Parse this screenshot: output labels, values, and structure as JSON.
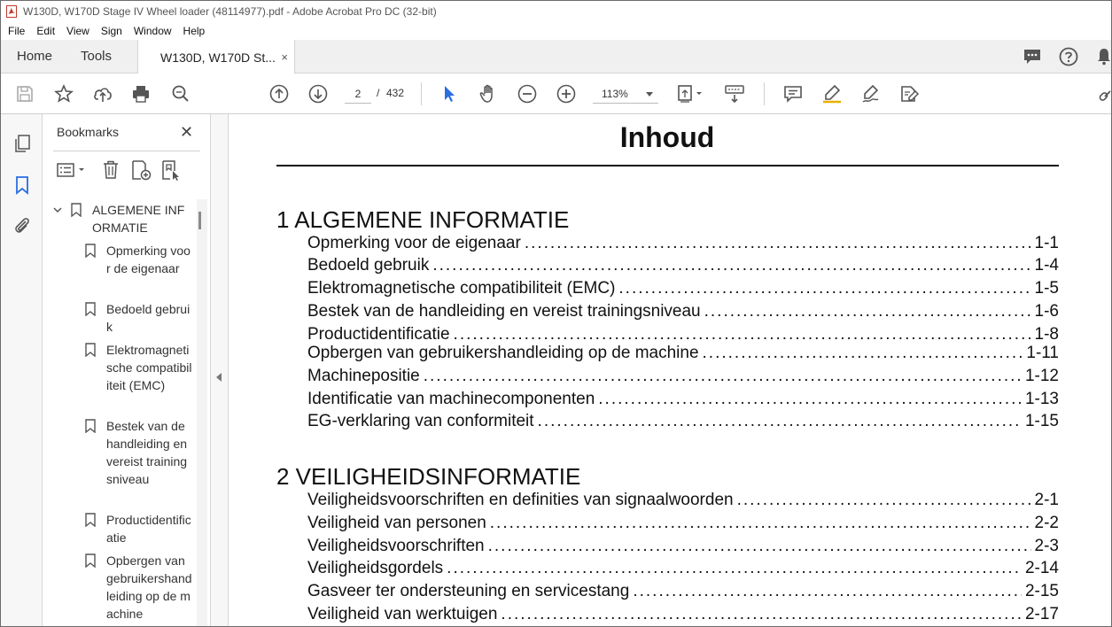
{
  "window": {
    "title": "W130D, W170D Stage IV Wheel loader (48114977).pdf - Adobe Acrobat Pro DC (32-bit)"
  },
  "menu": [
    "File",
    "Edit",
    "View",
    "Sign",
    "Window",
    "Help"
  ],
  "tabs": {
    "home": "Home",
    "tools": "Tools",
    "document": "W130D, W170D St...",
    "close": "×"
  },
  "toolbar": {
    "page_current": "2",
    "page_separator": "/",
    "page_total": "432",
    "zoom": "113%"
  },
  "bookmarks": {
    "header": "Bookmarks",
    "close": "✕",
    "items": [
      {
        "label": "ALGEMENE INFORMATIE",
        "level": 0
      },
      {
        "label": "Opmerking voor de eigenaar",
        "level": 1
      },
      {
        "label": "Bedoeld gebruik",
        "level": 1
      },
      {
        "label": "Elektromagnetische compatibiliteit (EMC)",
        "level": 1
      },
      {
        "label": "Bestek van de handleiding en vereist trainingsniveau",
        "level": 1
      },
      {
        "label": "Productidentificatie",
        "level": 1
      },
      {
        "label": "Opbergen van gebruikershandleiding op de machine",
        "level": 1
      }
    ]
  },
  "document": {
    "title": "Inhoud",
    "chapters": [
      {
        "heading": "1 ALGEMENE INFORMATIE",
        "entries": [
          {
            "text": "Opmerking voor de eigenaar",
            "page": "1-1"
          },
          {
            "text": "Bedoeld gebruik",
            "page": "1-4"
          },
          {
            "text": "Elektromagnetische compatibiliteit (EMC)",
            "page": "1-5"
          },
          {
            "text": "Bestek van de handleiding en vereist trainingsniveau",
            "page": "1-6"
          },
          {
            "text": "Productidentificatie",
            "page": "1-8"
          },
          {
            "text": "Opbergen van gebruikershandleiding op de machine",
            "page": "1-11"
          },
          {
            "text": "Machinepositie",
            "page": "1-12"
          },
          {
            "text": "Identificatie van machinecomponenten",
            "page": "1-13"
          },
          {
            "text": "EG-verklaring van conformiteit",
            "page": "1-15"
          }
        ]
      },
      {
        "heading": "2 VEILIGHEIDSINFORMATIE",
        "entries": [
          {
            "text": "Veiligheidsvoorschriften en definities van signaalwoorden",
            "page": "2-1"
          },
          {
            "text": "Veiligheid van personen",
            "page": "2-2"
          },
          {
            "text": "Veiligheidsvoorschriften",
            "page": "2-3"
          },
          {
            "text": "Veiligheidsgordels",
            "page": "2-14"
          },
          {
            "text": "Gasveer ter ondersteuning en servicestang",
            "page": "2-15"
          },
          {
            "text": "Veiligheid van werktuigen",
            "page": "2-17"
          }
        ]
      }
    ]
  }
}
